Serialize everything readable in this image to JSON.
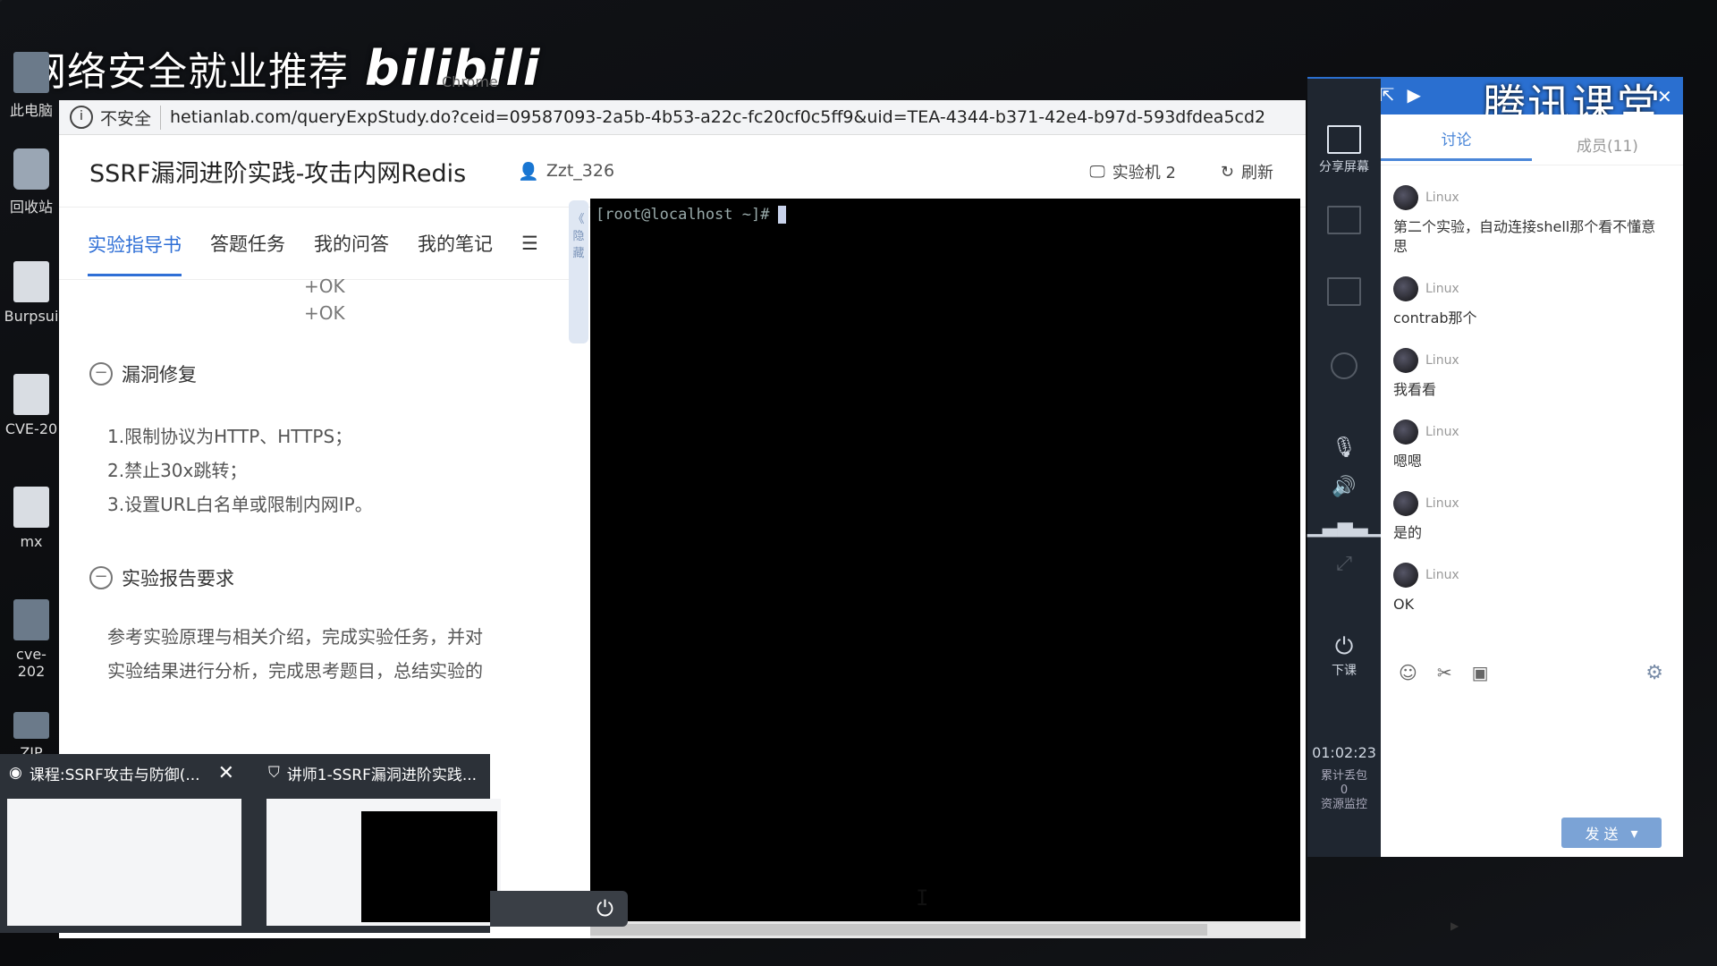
{
  "overlay": {
    "watermark_text": "网络安全就业推荐",
    "brand": "bilibili",
    "ghost_app": "Chrome"
  },
  "desktop_icons": [
    "此电脑",
    "回收站",
    "Burpsui",
    "CVE-20",
    "mx",
    "cve-202",
    "ZIP"
  ],
  "browser": {
    "insecure_label": "不安全",
    "url": "hetianlab.com/queryExpStudy.do?ceid=09587093-2a5b-4b53-a22c-fc20cf0c5ff9&uid=TEA-4344-b371-42e4-b97d-593dfdea5cd2",
    "page_title": "SSRF漏洞进阶实践-攻击内网Redis",
    "user": "Zzt_326",
    "machine_label": "实验机 2",
    "refresh_label": "刷新",
    "collapse_label": "《 隐藏"
  },
  "tabs": [
    {
      "label": "实验指导书",
      "active": true
    },
    {
      "label": "答题任务"
    },
    {
      "label": "我的问答"
    },
    {
      "label": "我的笔记"
    }
  ],
  "content": {
    "ok_lines": [
      "+OK",
      "+OK"
    ],
    "section1": "漏洞修复",
    "fixes": [
      "1.限制协议为HTTP、HTTPS；",
      "2.禁止30x跳转；",
      "3.设置URL白名单或限制内网IP。"
    ],
    "section2": "实验报告要求",
    "report_lines": [
      "参考实验原理与相关介绍，完成实验任务，并对",
      "实验结果进行分析，完成思考题目，总结实验的"
    ]
  },
  "terminal": {
    "prompt": "[root@localhost ~]#"
  },
  "tencent": {
    "brand": "腾讯课堂",
    "share_label": "分享屏幕",
    "leave_label": "下课",
    "time": "01:02:23",
    "stats": [
      "累计丢包",
      "0",
      "资源监控"
    ],
    "chat_tab": "讨论",
    "members_tab": "成员(11)",
    "messages": [
      {
        "user": "Linux",
        "text": "第二个实验，自动连接shell那个看不懂意思"
      },
      {
        "user": "Linux",
        "text": "contrab那个"
      },
      {
        "user": "Linux",
        "text": "我看看"
      },
      {
        "user": "Linux",
        "text": "嗯嗯"
      },
      {
        "user": "Linux",
        "text": "是的"
      },
      {
        "user": "Linux",
        "text": "OK"
      }
    ],
    "send_label": "发 送"
  },
  "taskbar": {
    "previews": [
      {
        "title": "课程:SSRF攻击与防御(..."
      },
      {
        "title": "讲师1-SSRF漏洞进阶实践..."
      }
    ]
  }
}
